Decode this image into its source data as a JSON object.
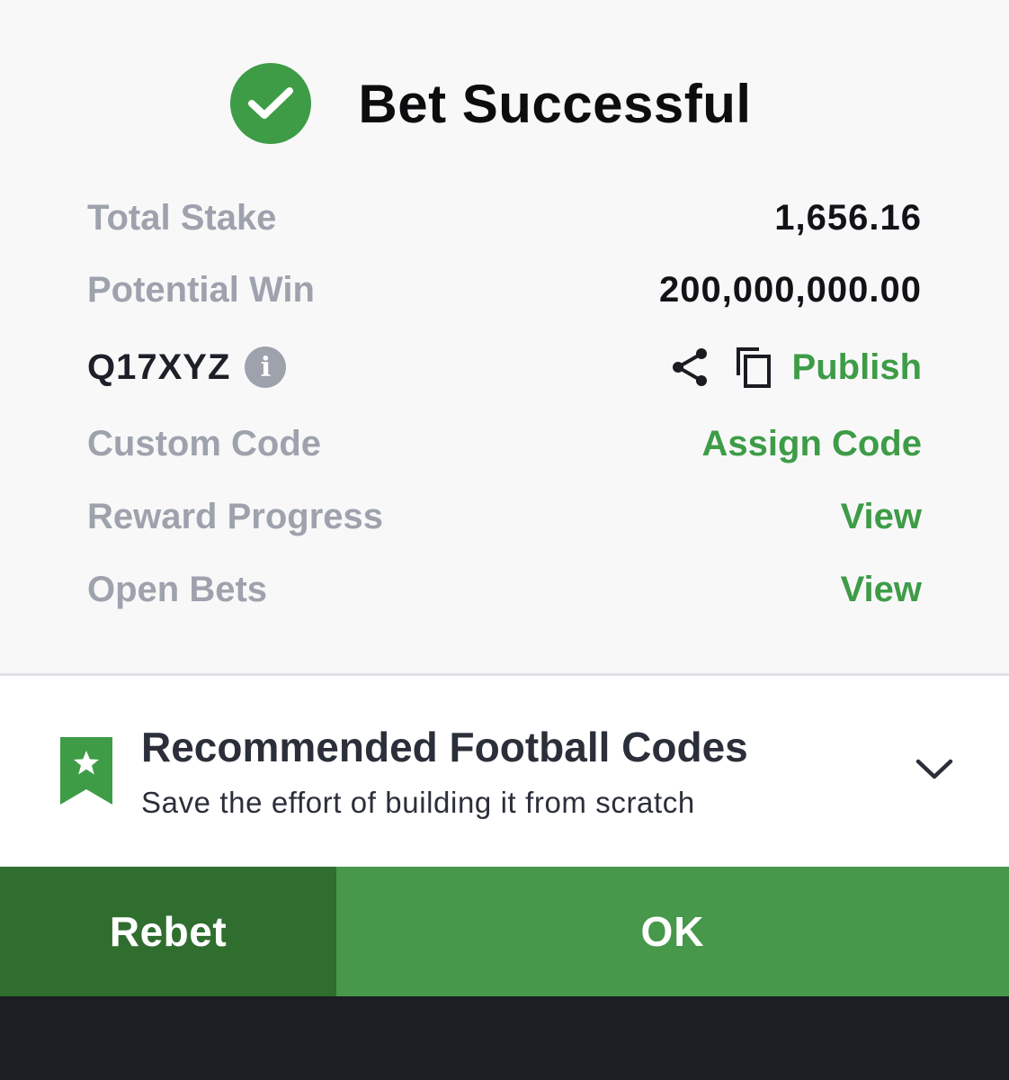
{
  "header": {
    "title": "Bet Successful",
    "icon": "check-circle-icon"
  },
  "details": {
    "total_stake_label": "Total Stake",
    "total_stake_value": "1,656.16",
    "potential_win_label": "Potential Win",
    "potential_win_value": "200,000,000.00",
    "booking_code": "Q17XYZ",
    "info_glyph": "i",
    "publish_label": "Publish",
    "custom_code_label": "Custom Code",
    "assign_code_label": "Assign Code",
    "reward_progress_label": "Reward Progress",
    "reward_view_label": "View",
    "open_bets_label": "Open Bets",
    "open_bets_view_label": "View"
  },
  "recommend": {
    "title": "Recommended Football Codes",
    "subtitle": "Save the effort of building it from scratch",
    "icon": "bookmark-star-icon"
  },
  "actions": {
    "rebet_label": "Rebet",
    "ok_label": "OK"
  },
  "colors": {
    "accent_green": "#3e9c47",
    "rebet_green": "#2f6e2e",
    "ok_green": "#47984a",
    "muted_label": "#9ea2ad",
    "bottom_bar": "#1c1e23"
  }
}
